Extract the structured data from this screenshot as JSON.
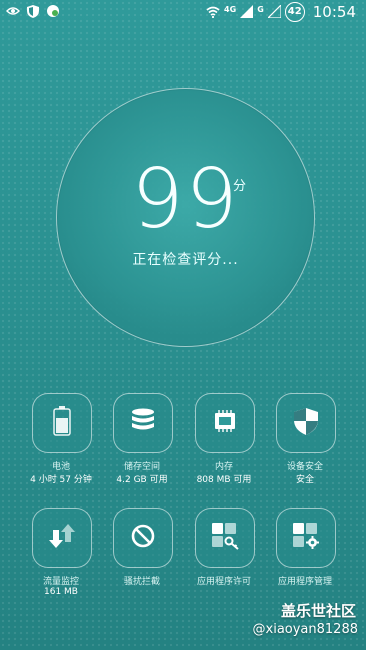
{
  "status_bar": {
    "network_badge": "4G",
    "network_type": "G",
    "battery_level": "42",
    "time": "10:54",
    "icons": [
      "eye-icon",
      "shield-icon",
      "app-icon",
      "wifi-icon",
      "signal-icon",
      "signal-icon-2"
    ]
  },
  "score": {
    "value": "99",
    "unit": "分",
    "status": "正在检查评分..."
  },
  "tiles": [
    {
      "icon": "battery-icon",
      "label": "电池",
      "value": "4 小时 57 分钟"
    },
    {
      "icon": "storage-icon",
      "label": "储存空间",
      "value": "4.2 GB 可用"
    },
    {
      "icon": "memory-icon",
      "label": "内存",
      "value": "808 MB 可用"
    },
    {
      "icon": "security-shield-icon",
      "label": "设备安全",
      "value": "安全"
    },
    {
      "icon": "data-usage-icon",
      "label": "流量监控",
      "value": "161 MB"
    },
    {
      "icon": "block-icon",
      "label": "骚扰拦截",
      "value": ""
    },
    {
      "icon": "app-permission-icon",
      "label": "应用程序许可",
      "value": ""
    },
    {
      "icon": "app-manager-icon",
      "label": "应用程序管理",
      "value": ""
    }
  ],
  "watermark": {
    "site": "盖乐世社区",
    "user": "@xiaoyan81288"
  },
  "colors": {
    "background": "#2a9090",
    "accent": "#ffffff"
  }
}
